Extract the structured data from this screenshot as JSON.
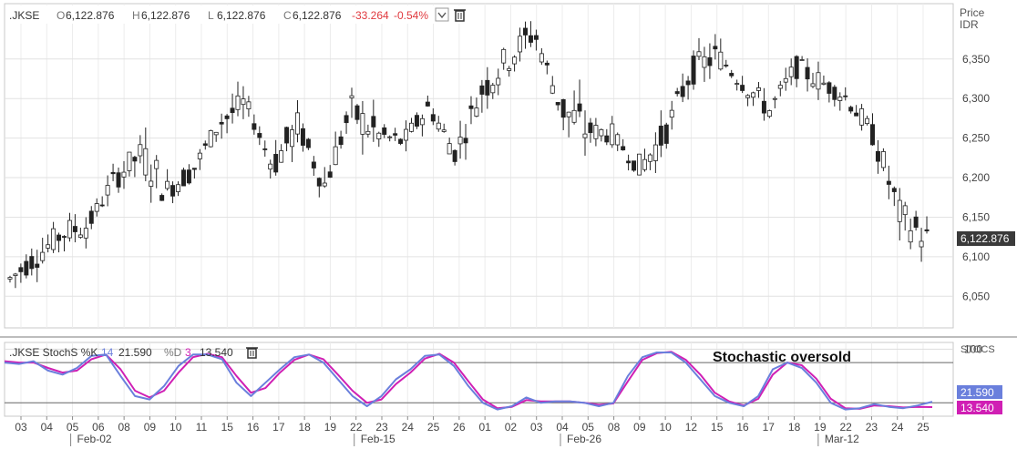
{
  "main_chart": {
    "symbol": ".JKSE",
    "ohlc_labels": [
      "O",
      "H",
      "L",
      "C"
    ],
    "ohlc_values": [
      "6,122.876",
      "6,122.876",
      "6,122.876",
      "6,122.876"
    ],
    "change": "-33.264",
    "change_pct": "-0.54%",
    "change_color": "#e0393e",
    "axis_title_1": "Price",
    "axis_title_2": "IDR",
    "last_price_label": "6,122.876",
    "dropdown_icon": "chevron-down-icon",
    "delete_icon": "trash-icon"
  },
  "stoch_panel": {
    "label": ".JKSE StochS %K",
    "k_period": "14",
    "k_value": "21.590",
    "d_label": "%D",
    "d_period": "3",
    "d_value": "13.540",
    "axis_title": "STOCS",
    "annotation": "Stochastic oversold",
    "k_color": "#6a7fdc",
    "d_color": "#d01fb4",
    "delete_icon": "trash-icon"
  },
  "chart_data": [
    {
      "type": "candlestick",
      "title": ".JKSE",
      "ylabel": "Price IDR",
      "ylim": [
        6010,
        6420
      ],
      "yticks": [
        "6,050",
        "6,100",
        "6,150",
        "6,200",
        "6,250",
        "6,300",
        "6,350"
      ],
      "last_price": 6122.876,
      "grid": true,
      "series": [
        {
          "name": ".JKSE",
          "day": "03",
          "open": 6085,
          "high": 6098,
          "low": 6030,
          "close": 6072
        },
        {
          "name": ".JKSE",
          "day": "04",
          "open": 6072,
          "high": 6120,
          "low": 6045,
          "close": 6100
        },
        {
          "name": ".JKSE",
          "day": "05",
          "open": 6100,
          "high": 6150,
          "low": 6070,
          "close": 6130
        },
        {
          "name": ".JKSE",
          "day": "06",
          "open": 6125,
          "high": 6148,
          "low": 6095,
          "close": 6140
        },
        {
          "name": ".JKSE",
          "day": "08",
          "open": 6140,
          "high": 6210,
          "low": 6130,
          "close": 6200
        },
        {
          "name": ".JKSE",
          "day": "09",
          "open": 6200,
          "high": 6285,
          "low": 6160,
          "close": 6230
        },
        {
          "name": ".JKSE",
          "day": "10",
          "open": 6230,
          "high": 6240,
          "low": 6170,
          "close": 6185
        },
        {
          "name": ".JKSE",
          "day": "11",
          "open": 6185,
          "high": 6230,
          "low": 6175,
          "close": 6210
        },
        {
          "name": ".JKSE",
          "day": "15",
          "open": 6210,
          "high": 6285,
          "low": 6205,
          "close": 6270
        },
        {
          "name": ".JKSE",
          "day": "16",
          "open": 6270,
          "high": 6300,
          "low": 6260,
          "close": 6295
        },
        {
          "name": ".JKSE",
          "day": "17",
          "open": 6295,
          "high": 6310,
          "low": 6200,
          "close": 6215
        },
        {
          "name": ".JKSE",
          "day": "18",
          "open": 6215,
          "high": 6280,
          "low": 6205,
          "close": 6265
        },
        {
          "name": ".JKSE",
          "day": "19",
          "open": 6265,
          "high": 6270,
          "low": 6180,
          "close": 6190
        },
        {
          "name": ".JKSE",
          "day": "22",
          "open": 6190,
          "high": 6295,
          "low": 6185,
          "close": 6285
        },
        {
          "name": ".JKSE",
          "day": "23",
          "open": 6285,
          "high": 6290,
          "low": 6240,
          "close": 6255
        },
        {
          "name": ".JKSE",
          "day": "24",
          "open": 6255,
          "high": 6290,
          "low": 6235,
          "close": 6245
        },
        {
          "name": ".JKSE",
          "day": "25",
          "open": 6245,
          "high": 6300,
          "low": 6240,
          "close": 6290
        },
        {
          "name": ".JKSE",
          "day": "26",
          "open": 6290,
          "high": 6295,
          "low": 6210,
          "close": 6230
        },
        {
          "name": ".JKSE",
          "day": "01",
          "open": 6230,
          "high": 6320,
          "low": 6220,
          "close": 6310
        },
        {
          "name": ".JKSE",
          "day": "02",
          "open": 6310,
          "high": 6395,
          "low": 6300,
          "close": 6350
        },
        {
          "name": ".JKSE",
          "day": "03",
          "open": 6350,
          "high": 6395,
          "low": 6335,
          "close": 6385
        },
        {
          "name": ".JKSE",
          "day": "04",
          "open": 6385,
          "high": 6390,
          "low": 6250,
          "close": 6290
        },
        {
          "name": ".JKSE",
          "day": "05",
          "open": 6290,
          "high": 6300,
          "low": 6240,
          "close": 6260
        },
        {
          "name": ".JKSE",
          "day": "08",
          "open": 6260,
          "high": 6275,
          "low": 6240,
          "close": 6255
        },
        {
          "name": ".JKSE",
          "day": "09",
          "open": 6255,
          "high": 6265,
          "low": 6175,
          "close": 6210
        },
        {
          "name": ".JKSE",
          "day": "10",
          "open": 6210,
          "high": 6275,
          "low": 6195,
          "close": 6255
        },
        {
          "name": ".JKSE",
          "day": "12",
          "open": 6255,
          "high": 6340,
          "low": 6250,
          "close": 6335
        },
        {
          "name": ".JKSE",
          "day": "15",
          "open": 6335,
          "high": 6385,
          "low": 6320,
          "close": 6355
        },
        {
          "name": ".JKSE",
          "day": "16",
          "open": 6355,
          "high": 6360,
          "low": 6290,
          "close": 6320
        },
        {
          "name": ".JKSE",
          "day": "17",
          "open": 6320,
          "high": 6325,
          "low": 6270,
          "close": 6285
        },
        {
          "name": ".JKSE",
          "day": "18",
          "open": 6285,
          "high": 6345,
          "low": 6280,
          "close": 6340
        },
        {
          "name": ".JKSE",
          "day": "19",
          "open": 6340,
          "high": 6360,
          "low": 6310,
          "close": 6320
        },
        {
          "name": ".JKSE",
          "day": "22",
          "open": 6320,
          "high": 6355,
          "low": 6290,
          "close": 6300
        },
        {
          "name": ".JKSE",
          "day": "23",
          "open": 6300,
          "high": 6340,
          "low": 6240,
          "close": 6250
        },
        {
          "name": ".JKSE",
          "day": "24",
          "open": 6250,
          "high": 6250,
          "low": 6140,
          "close": 6150
        },
        {
          "name": ".JKSE",
          "day": "25",
          "open": 6150,
          "high": 6160,
          "low": 6060,
          "close": 6122.876
        }
      ]
    },
    {
      "type": "line",
      "title": ".JKSE StochS %K 14 %D 3",
      "ylabel": "STOCS",
      "ylim": [
        0,
        110
      ],
      "yticks": [
        "100"
      ],
      "reference_lines": [
        80,
        20
      ],
      "x_categories": [
        "03",
        "04",
        "05",
        "06",
        "08",
        "09",
        "10",
        "11",
        "15",
        "16",
        "17",
        "18",
        "19",
        "22",
        "23",
        "24",
        "25",
        "26",
        "01",
        "02",
        "03",
        "04",
        "05",
        "08",
        "09",
        "10",
        "12",
        "15",
        "16",
        "17",
        "18",
        "19",
        "22",
        "23",
        "24",
        "25"
      ],
      "month_labels": [
        {
          "label": "Feb-02",
          "at": "05"
        },
        {
          "label": "Feb-15",
          "at": "22"
        },
        {
          "label": "Feb-26",
          "at": "04"
        },
        {
          "label": "Mar-12",
          "at": "19"
        }
      ],
      "series": [
        {
          "name": "%K",
          "values": [
            80,
            78,
            82,
            68,
            62,
            72,
            90,
            92,
            60,
            30,
            25,
            45,
            75,
            92,
            92,
            85,
            50,
            30,
            50,
            70,
            88,
            92,
            80,
            55,
            30,
            15,
            30,
            55,
            70,
            90,
            92,
            75,
            45,
            20,
            10,
            15,
            28,
            20,
            22,
            22,
            20,
            15,
            20,
            60,
            88,
            95,
            95,
            80,
            55,
            30,
            20,
            15,
            30,
            70,
            80,
            72,
            50,
            20,
            10,
            12,
            18,
            14,
            12,
            16,
            21.59
          ]
        },
        {
          "name": "%D",
          "values": [
            82,
            80,
            80,
            72,
            65,
            68,
            85,
            92,
            70,
            38,
            28,
            38,
            65,
            88,
            93,
            88,
            60,
            35,
            42,
            65,
            84,
            92,
            85,
            62,
            38,
            20,
            25,
            48,
            65,
            86,
            93,
            80,
            52,
            25,
            12,
            14,
            24,
            22,
            22,
            22,
            20,
            17,
            19,
            52,
            84,
            94,
            96,
            84,
            62,
            35,
            22,
            16,
            26,
            62,
            80,
            76,
            56,
            26,
            12,
            11,
            16,
            15,
            13,
            14,
            13.54
          ]
        }
      ]
    }
  ]
}
